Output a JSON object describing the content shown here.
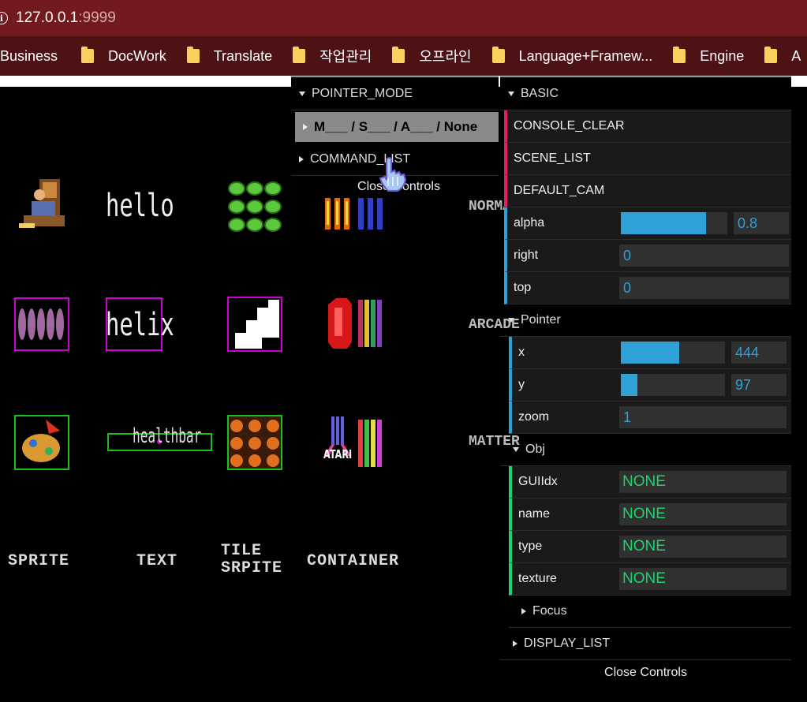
{
  "browser": {
    "url_host": "127.0.0.1",
    "url_port": ":9999",
    "info_glyph": "i",
    "bookmarks": [
      "Business",
      "DocWork",
      "Translate",
      "작업관리",
      "오프라인",
      "Language+Framew...",
      "Engine",
      "A"
    ]
  },
  "stage": {
    "text_hello": "hello",
    "text_helix": "helix",
    "text_healthbar": "healthbar",
    "text_atari": "ATARI",
    "row_labels": [
      "NORMAL",
      "ARCADE",
      "MATTER"
    ],
    "col_labels": {
      "sprite": "SPRITE",
      "text": "TEXT",
      "tile_line1": "TILE",
      "tile_line2": "SRPITE",
      "container": "CONTAINER"
    }
  },
  "left_gui": {
    "pointer_mode_title": "POINTER_MODE",
    "pointer_mode_value": "M___ / S___ / A___ / None",
    "command_list_title": "COMMAND_LIST",
    "close_label": "Close Controls"
  },
  "right_gui": {
    "basic_title": "BASIC",
    "funcs": [
      "CONSOLE_CLEAR",
      "SCENE_LIST",
      "DEFAULT_CAM"
    ],
    "alpha": {
      "label": "alpha",
      "value": "0.8",
      "fill": 0.8
    },
    "right": {
      "label": "right",
      "value": "0"
    },
    "top": {
      "label": "top",
      "value": "0"
    },
    "pointer_title": "Pointer",
    "x": {
      "label": "x",
      "value": "444",
      "fill": 0.56
    },
    "y": {
      "label": "y",
      "value": "97",
      "fill": 0.16
    },
    "zoom": {
      "label": "zoom",
      "value": "1"
    },
    "obj_title": "Obj",
    "obj_fields": [
      {
        "label": "GUIIdx",
        "value": "NONE"
      },
      {
        "label": "name",
        "value": "NONE"
      },
      {
        "label": "type",
        "value": "NONE"
      },
      {
        "label": "texture",
        "value": "NONE"
      }
    ],
    "focus_title": "Focus",
    "display_list_title": "DISPLAY_LIST",
    "close_label": "Close Controls"
  },
  "colors": {
    "address_bar": "#721a1e",
    "bookmark_bar": "#4d1213",
    "func_bar": "#e61d5f",
    "number_bar": "#2fa1d6",
    "string_bar": "#1ed36f",
    "arcade_outline": "#d000d0",
    "matter_outline": "#19c119"
  }
}
